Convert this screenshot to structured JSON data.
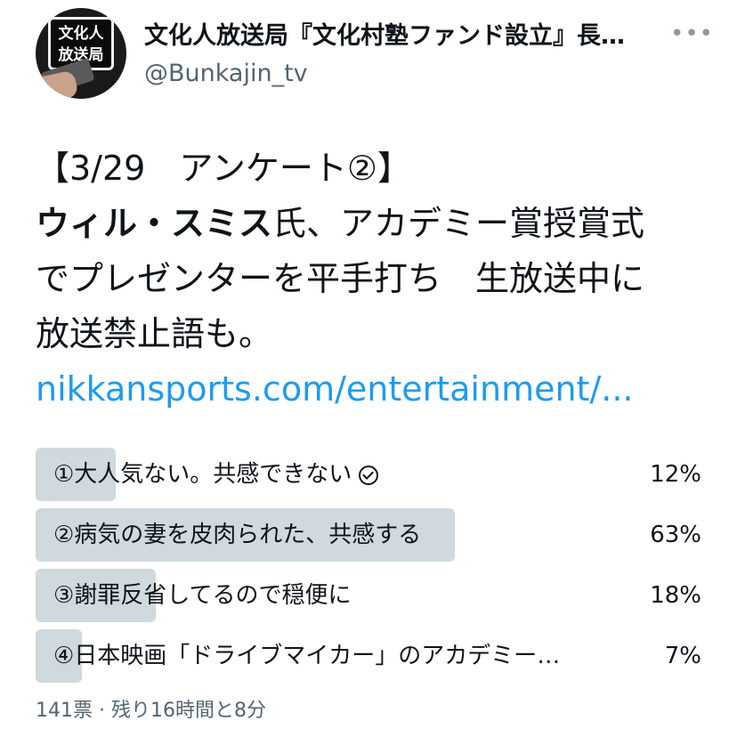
{
  "account": {
    "avatar_text_1": "文化人",
    "avatar_text_2": "放送局",
    "name": "文化人放送局『文化村塾ファンド設立』長…",
    "handle": "@Bunkajin_tv",
    "more": "•••"
  },
  "tweet": {
    "line1": "【3/29　アンケート②】",
    "line2_bold": "ウィル・スミス",
    "line2_rest": "氏、アカデミー賞授賞式",
    "line3": "でプレゼンターを平手打ち　生放送中に",
    "line4": "放送禁止語も。",
    "link": "nikkansports.com/entertainment/..."
  },
  "poll": {
    "options": [
      {
        "label": "①大人気ない。共感できない",
        "percent_text": "12%",
        "percent": 12,
        "selected": true
      },
      {
        "label": "②病気の妻を皮肉られた、共感する",
        "percent_text": "63%",
        "percent": 63,
        "selected": false
      },
      {
        "label": "③謝罪反省してるので穏便に",
        "percent_text": "18%",
        "percent": 18,
        "selected": false
      },
      {
        "label": "④日本映画「ドライブマイカー」のアカデミー…",
        "percent_text": "7%",
        "percent": 7,
        "selected": false
      }
    ],
    "meta": "141票 · 残り16時間と8分"
  },
  "colors": {
    "bar": "#cfd9de",
    "link": "#1d9bf0",
    "secondary_text": "#536471"
  }
}
